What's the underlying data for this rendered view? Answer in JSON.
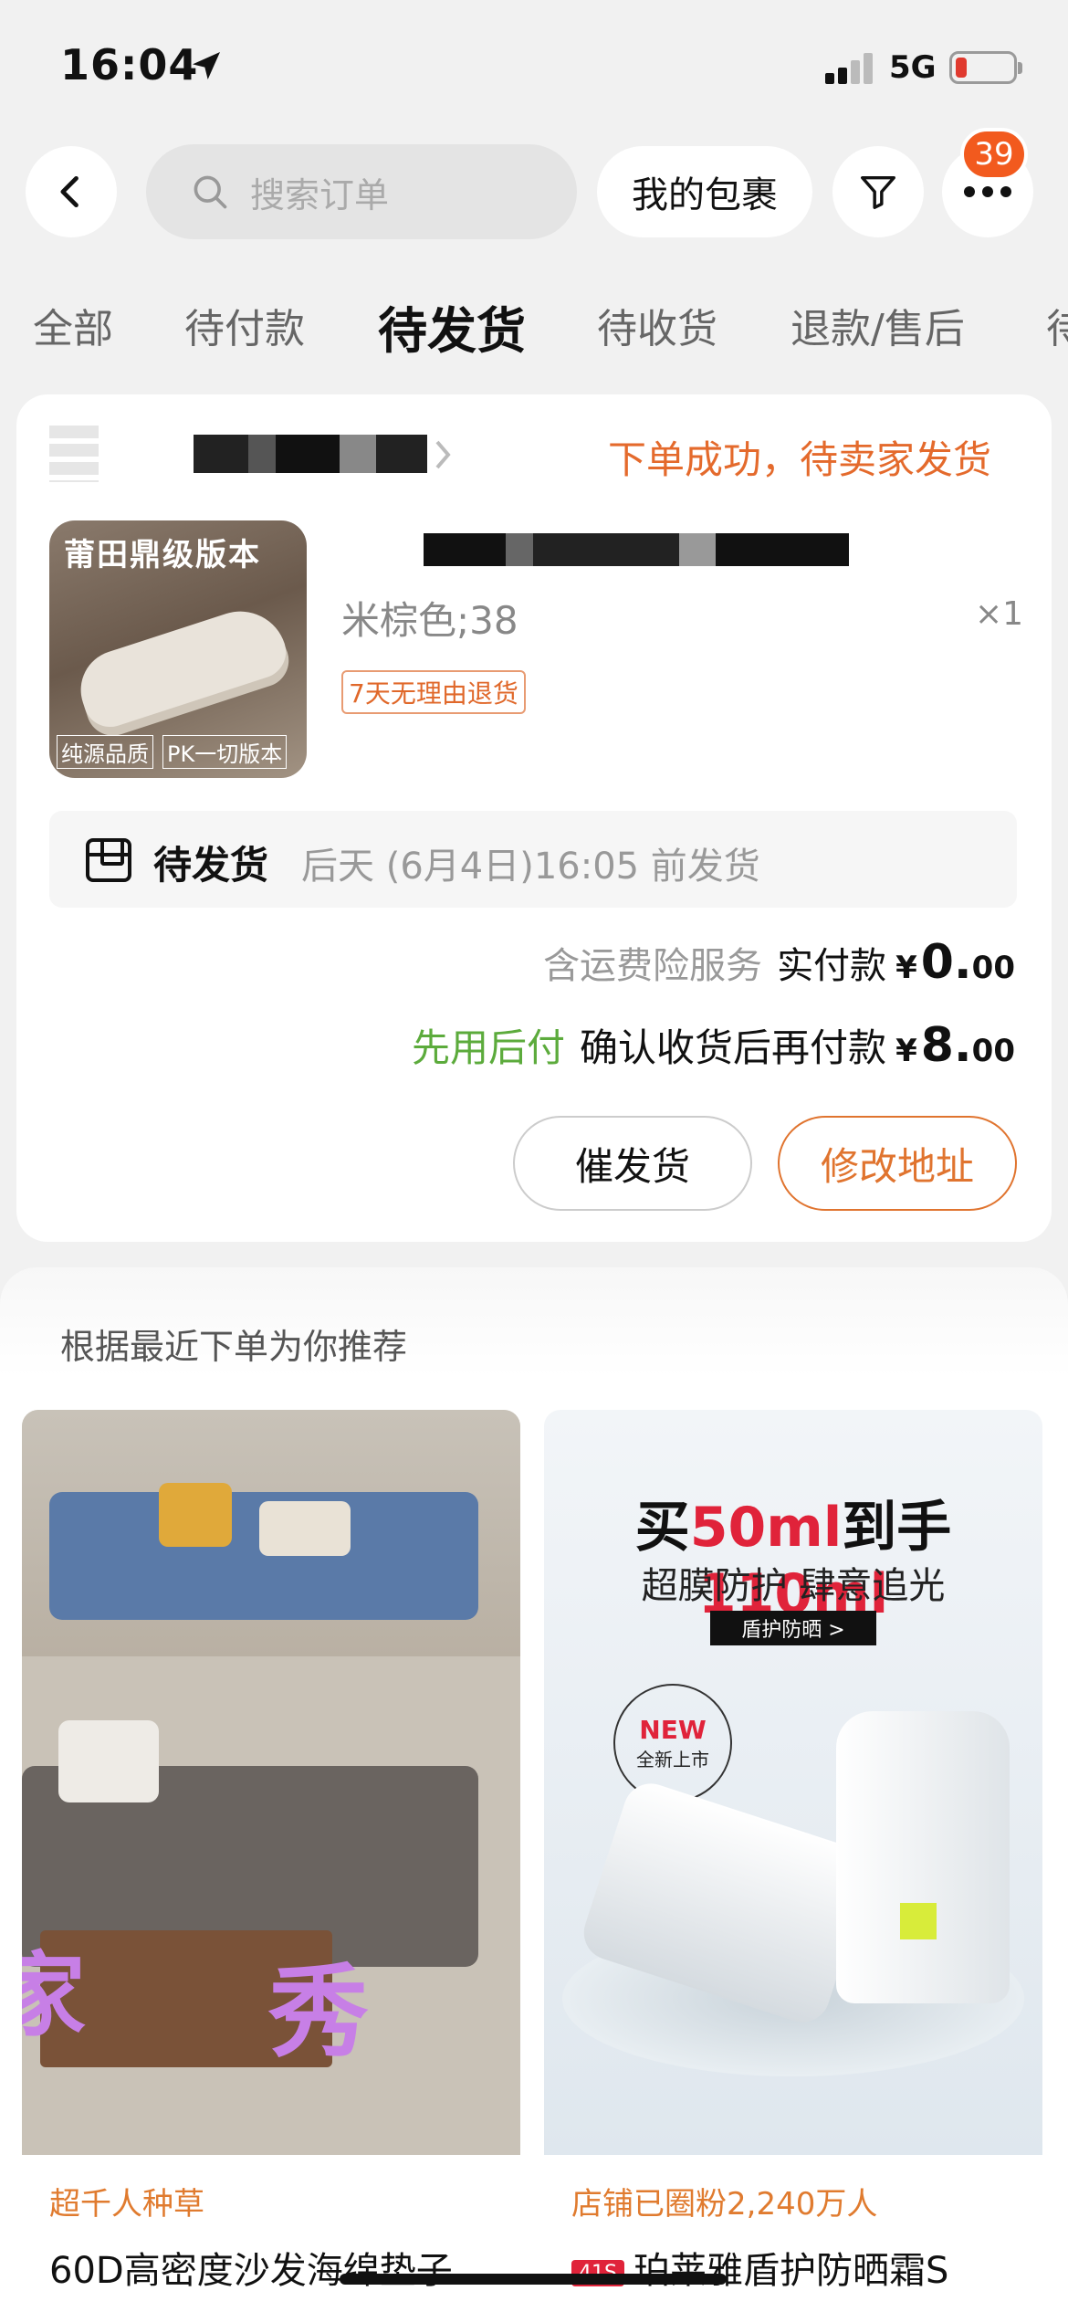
{
  "status_bar": {
    "time": "16:04",
    "network": "5G"
  },
  "header": {
    "search_placeholder": "搜索订单",
    "my_packages": "我的包裹",
    "notification_count": "39"
  },
  "tabs": [
    "全部",
    "待付款",
    "待发货",
    "待收货",
    "退款/售后",
    "待"
  ],
  "order": {
    "status_message": "下单成功，待卖家发货",
    "thumb_title": "莆田鼎级版本",
    "thumb_sub1": "纯源品质",
    "thumb_sub2": "PK一切版本",
    "variant": "米棕色;38",
    "quantity": "×1",
    "return_tag": "7天无理由退货",
    "ship_label": "待发货",
    "ship_deadline": "后天 (6月4日)16:05 前发货",
    "insurance_text": "含运费险服务",
    "paid_label": "实付款",
    "paid_yen": "¥",
    "paid_int": "0.",
    "paid_dec": "00",
    "pay_later": "先用后付",
    "pay_after_label": "确认收货后再付款",
    "pay_after_yen": "¥",
    "pay_after_int": "8.",
    "pay_after_dec": "00",
    "urge_button": "催发货",
    "change_address_button": "修改地址"
  },
  "recommend": {
    "title": "根据最近下单为你推荐",
    "items": [
      {
        "tag": "超千人种草",
        "name": "60D高密度沙发海绵垫子",
        "overlay_left": "家",
        "overlay_right": "秀"
      },
      {
        "tag": "店铺已圈粉2,240万人",
        "brand_chip": "41S",
        "name": "珀莱雅盾护防晒霜S",
        "ad_pre": "买",
        "ad_hl1": "50ml",
        "ad_mid": "到手",
        "ad_hl2": "110ml",
        "ad_line2": "超膜防护 肆意追光",
        "ad_button": "盾护防晒 >",
        "new_big": "NEW",
        "new_small": "全新上市"
      }
    ]
  },
  "colors": {
    "accent": "#e46a2c",
    "green": "#5cab3c",
    "badge": "#f25a1e"
  }
}
